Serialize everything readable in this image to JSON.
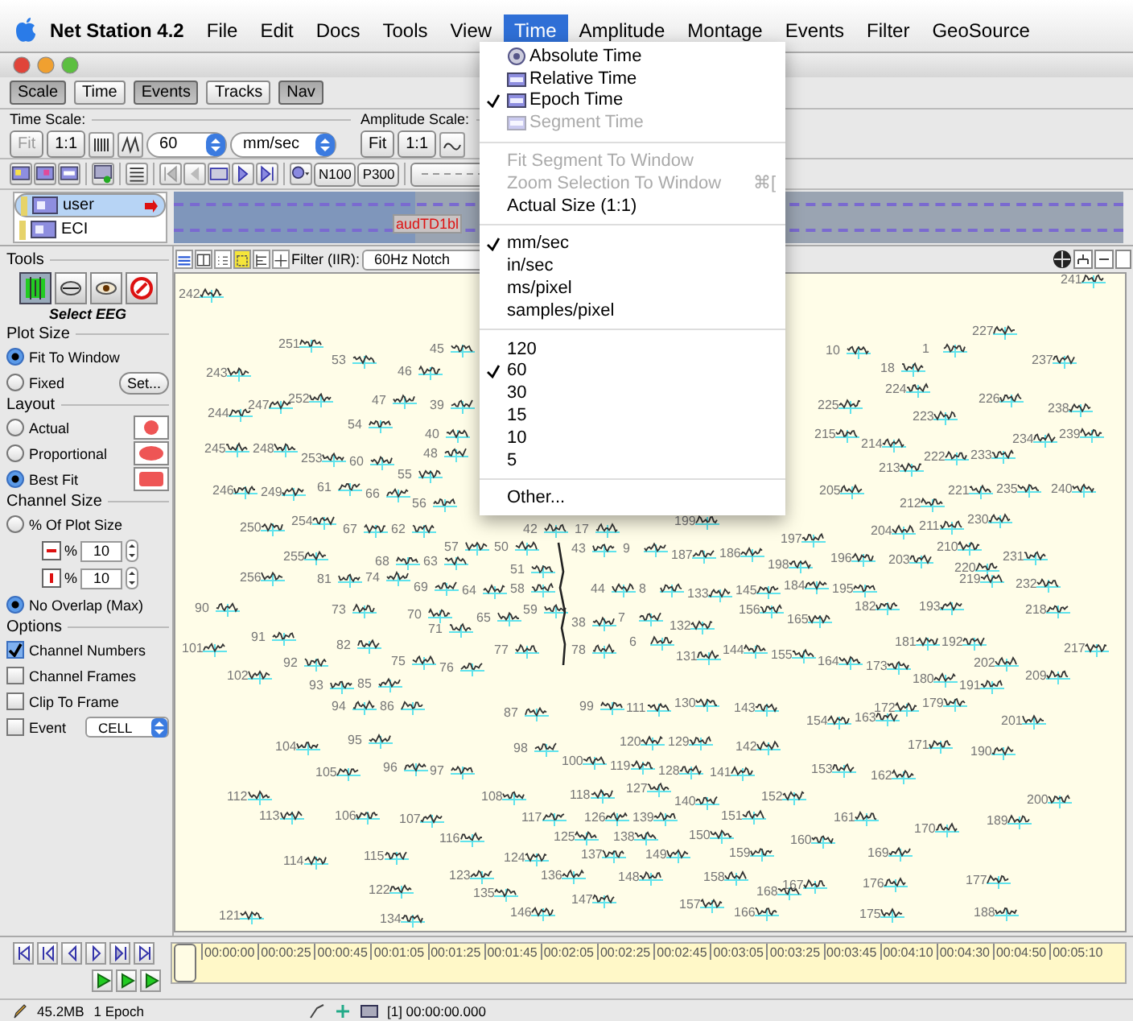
{
  "menubar": {
    "app": "Net Station 4.2",
    "items": [
      {
        "label": "File",
        "selected": false
      },
      {
        "label": "Edit",
        "selected": false
      },
      {
        "label": "Docs",
        "selected": false
      },
      {
        "label": "Tools",
        "selected": false
      },
      {
        "label": "View",
        "selected": false
      },
      {
        "label": "Time",
        "selected": true
      },
      {
        "label": "Amplitude",
        "selected": false
      },
      {
        "label": "Montage",
        "selected": false
      },
      {
        "label": "Events",
        "selected": false
      },
      {
        "label": "Filter",
        "selected": false
      },
      {
        "label": "GeoSource",
        "selected": false
      }
    ]
  },
  "toolbar_tabs": [
    {
      "label": "Scale",
      "on": true
    },
    {
      "label": "Time",
      "on": false
    },
    {
      "label": "Events",
      "on": true
    },
    {
      "label": "Tracks",
      "on": false
    },
    {
      "label": "Nav",
      "on": true
    }
  ],
  "time_scale": {
    "title": "Time Scale:",
    "buttons": [
      {
        "label": "Fit",
        "disabled": true
      },
      {
        "label": "1:1",
        "disabled": false
      }
    ],
    "rate": "60",
    "unit": "mm/sec"
  },
  "amplitude_scale": {
    "title": "Amplitude Scale:",
    "buttons": [
      {
        "label": "Fit",
        "disabled": false
      },
      {
        "label": "1:1",
        "disabled": false
      }
    ]
  },
  "event_buttons": [
    "N100",
    "P300"
  ],
  "tracks": [
    {
      "name": "user",
      "selected": true
    },
    {
      "name": "ECI",
      "selected": false
    }
  ],
  "track_marker": "audTD1bl",
  "tools_panel": {
    "title": "Tools",
    "tool_caption": "Select EEG",
    "tools": [
      {
        "kind": "select",
        "selected": true
      },
      {
        "kind": "pan",
        "selected": false
      },
      {
        "kind": "eye",
        "selected": false
      },
      {
        "kind": "stop",
        "selected": false
      }
    ],
    "plot_size": {
      "title": "Plot Size",
      "options": [
        {
          "label": "Fit To Window",
          "selected": true
        },
        {
          "label": "Fixed",
          "selected": false
        }
      ],
      "set_button": "Set..."
    },
    "layout": {
      "title": "Layout",
      "options": [
        {
          "label": "Actual",
          "selected": false,
          "kind": "circle"
        },
        {
          "label": "Proportional",
          "selected": false,
          "kind": "ellipse"
        },
        {
          "label": "Best Fit",
          "selected": true,
          "kind": "rect"
        }
      ]
    },
    "channel_size": {
      "title": "Channel Size",
      "options": [
        {
          "label": "% Of Plot Size",
          "selected": false
        },
        {
          "label": "No Overlap (Max)",
          "selected": true
        }
      ],
      "spinners": [
        {
          "kind": "width",
          "unit": "%",
          "value": "10"
        },
        {
          "kind": "height",
          "unit": "%",
          "value": "10"
        }
      ]
    },
    "options": {
      "title": "Options",
      "checkboxes": [
        {
          "label": "Channel Numbers",
          "checked": true
        },
        {
          "label": "Channel Frames",
          "checked": false
        },
        {
          "label": "Clip To Frame",
          "checked": false
        },
        {
          "label": "Event",
          "checked": false
        }
      ],
      "event_select": "CELL"
    }
  },
  "view_toolbar": {
    "filter_label": "Filter (IIR):",
    "filter": "60Hz Notch"
  },
  "channels": [
    "242",
    "241",
    "227",
    "251",
    "53",
    "45",
    "10",
    "1",
    "237",
    "46",
    "18",
    "243",
    "252",
    "47",
    "39",
    "225",
    "224",
    "223",
    "226",
    "238",
    "244",
    "247",
    "54",
    "40",
    "215",
    "214",
    "222",
    "234",
    "239",
    "245",
    "248",
    "253",
    "60",
    "48",
    "213",
    "233",
    "55",
    "246",
    "249",
    "61",
    "66",
    "56",
    "50",
    "42",
    "17",
    "199",
    "205",
    "212",
    "221",
    "235",
    "240",
    "250",
    "254",
    "67",
    "62",
    "57",
    "43",
    "9",
    "187",
    "186",
    "197",
    "204",
    "211",
    "230",
    "220",
    "255",
    "68",
    "63",
    "51",
    "198",
    "196",
    "203",
    "210",
    "231",
    "256",
    "81",
    "74",
    "69",
    "64",
    "58",
    "44",
    "8",
    "133",
    "145",
    "184",
    "195",
    "219",
    "232",
    "90",
    "73",
    "82",
    "70",
    "71",
    "65",
    "59",
    "38",
    "7",
    "132",
    "156",
    "165",
    "182",
    "193",
    "218",
    "101",
    "91",
    "75",
    "77",
    "78",
    "6",
    "131",
    "144",
    "155",
    "164",
    "173",
    "181",
    "192",
    "217",
    "92",
    "102",
    "93",
    "85",
    "76",
    "180",
    "191",
    "202",
    "209",
    "94",
    "86",
    "87",
    "99",
    "111",
    "130",
    "143",
    "154",
    "163",
    "172",
    "179",
    "201",
    "104",
    "95",
    "98",
    "120",
    "129",
    "142",
    "171",
    "190",
    "105",
    "96",
    "97",
    "100",
    "119",
    "128",
    "141",
    "153",
    "162",
    "127",
    "112",
    "108",
    "118",
    "140",
    "152",
    "200",
    "113",
    "106",
    "107",
    "117",
    "126",
    "139",
    "151",
    "161",
    "170",
    "189",
    "116",
    "125",
    "138",
    "150",
    "160",
    "114",
    "115",
    "124",
    "137",
    "149",
    "159",
    "169",
    "123",
    "136",
    "148",
    "158",
    "167",
    "176",
    "177",
    "122",
    "135",
    "168",
    "121",
    "134",
    "146",
    "147",
    "157",
    "166",
    "175",
    "188"
  ],
  "time_menu": {
    "items": [
      {
        "kind": "clock_item",
        "label": "Absolute Time",
        "checked": false,
        "disabled": false
      },
      {
        "kind": "window_item",
        "label": "Relative Time",
        "checked": false,
        "disabled": false
      },
      {
        "kind": "window_item",
        "label": "Epoch Time",
        "checked": true,
        "disabled": false
      },
      {
        "kind": "window_item",
        "label": "Segment Time",
        "checked": false,
        "disabled": true
      },
      {
        "kind": "separator"
      },
      {
        "kind": "item",
        "label": "Fit Segment To Window",
        "checked": false,
        "disabled": true
      },
      {
        "kind": "item",
        "label": "Zoom Selection To Window",
        "shortcut": "⌘[",
        "checked": false,
        "disabled": true
      },
      {
        "kind": "item",
        "label": "Actual Size (1:1)",
        "checked": false,
        "disabled": false
      },
      {
        "kind": "separator"
      },
      {
        "kind": "item",
        "label": "mm/sec",
        "checked": true,
        "disabled": false
      },
      {
        "kind": "item",
        "label": "in/sec",
        "checked": false,
        "disabled": false
      },
      {
        "kind": "item",
        "label": "ms/pixel",
        "checked": false,
        "disabled": false
      },
      {
        "kind": "item",
        "label": "samples/pixel",
        "checked": false,
        "disabled": false
      },
      {
        "kind": "separator"
      },
      {
        "kind": "item",
        "label": "120",
        "checked": false,
        "disabled": false
      },
      {
        "kind": "item",
        "label": "60",
        "checked": true,
        "disabled": false
      },
      {
        "kind": "item",
        "label": "30",
        "checked": false,
        "disabled": false
      },
      {
        "kind": "item",
        "label": "15",
        "checked": false,
        "disabled": false
      },
      {
        "kind": "item",
        "label": "10",
        "checked": false,
        "disabled": false
      },
      {
        "kind": "item",
        "label": "5",
        "checked": false,
        "disabled": false
      },
      {
        "kind": "separator"
      },
      {
        "kind": "item",
        "label": "Other...",
        "checked": false,
        "disabled": false
      }
    ]
  },
  "timeline": {
    "ticks": [
      "00:00:00",
      "00:00:25",
      "00:00:45",
      "00:01:05",
      "00:01:25",
      "00:01:45",
      "00:02:05",
      "00:02:25",
      "00:02:45",
      "00:03:05",
      "00:03:25",
      "00:03:45",
      "00:04:10",
      "00:04:30",
      "00:04:50",
      "00:05:10"
    ]
  },
  "status_bar": {
    "memory": "45.2MB",
    "epochs": "1 Epoch",
    "time": "[1] 00:00:00.000"
  }
}
